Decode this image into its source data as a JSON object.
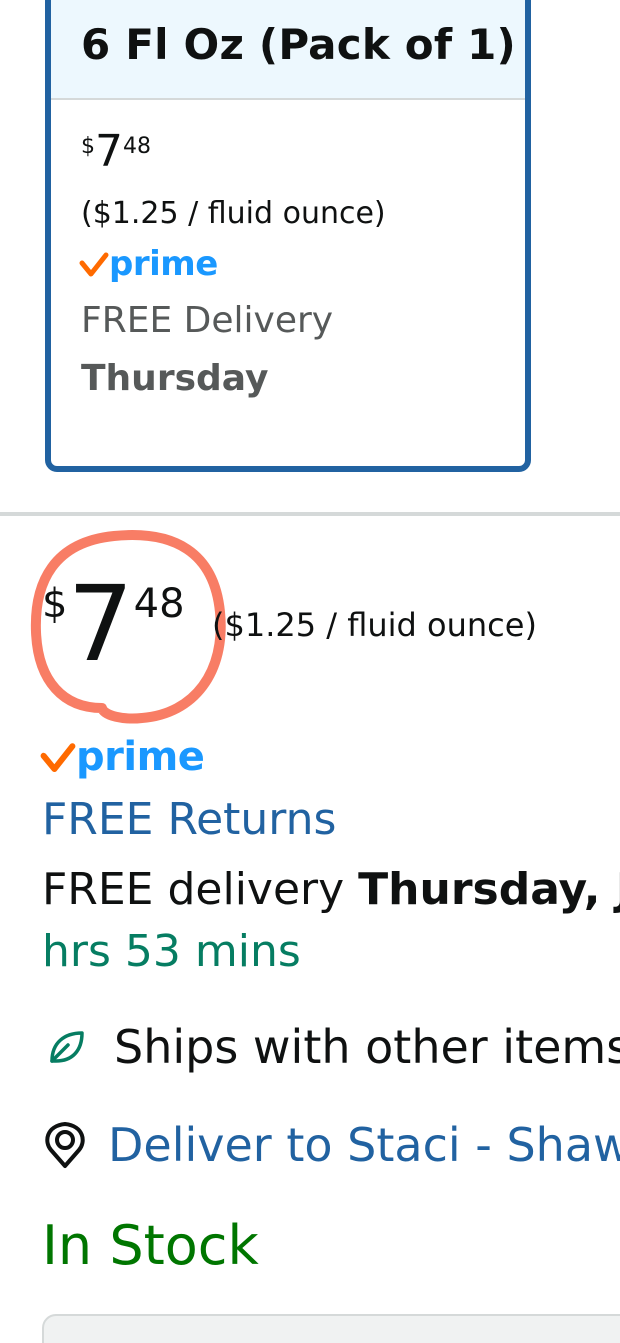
{
  "variation": {
    "title": "6 Fl Oz (Pack of 1)",
    "price_symbol": "$",
    "price_whole": "7",
    "price_fraction": "48",
    "unit_price": "($1.25 / fluid ounce)",
    "prime_label": "prime",
    "delivery_label": "FREE Delivery",
    "delivery_day": "Thursday"
  },
  "offer": {
    "price_symbol": "$",
    "price_whole": "7",
    "price_fraction": "48",
    "unit_price": "($1.25 / fluid ounce)",
    "prime_label": "prime",
    "returns_link": "FREE Returns",
    "delivery_prefix": "FREE delivery ",
    "delivery_date": "Thursday, Ju",
    "countdown": "hrs 53 mins",
    "ships_with": "Ships with other items i",
    "deliver_to": "Deliver to Staci - Shawn",
    "stock_status": "In Stock"
  },
  "colors": {
    "link_blue": "#2162a1",
    "prime_blue": "#1a98ff",
    "prime_check": "#ff6a00",
    "stock_green": "#007600",
    "countdown_green": "#067d62",
    "annotation_circle": "#f7664a"
  },
  "icons": {
    "ships_icon": "leaf-icon",
    "location_icon": "location-pin-icon",
    "prime_check": "check-icon"
  }
}
